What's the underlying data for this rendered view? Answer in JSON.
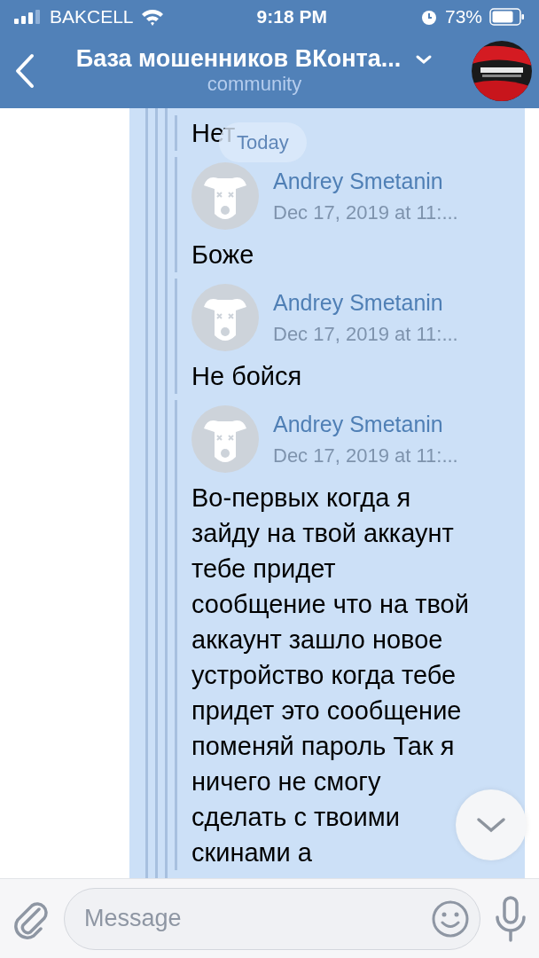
{
  "status_bar": {
    "carrier": "BAKCELL",
    "time": "9:18 PM",
    "battery": "73%"
  },
  "header": {
    "title": "База мошенников ВКонта...",
    "subtitle": "community"
  },
  "date_pill": "Today",
  "messages": [
    {
      "text": "Нет"
    },
    {
      "author": "Andrey Smetanin",
      "date": "Dec 17, 2019 at 11:...",
      "text": "Боже"
    },
    {
      "author": "Andrey Smetanin",
      "date": "Dec 17, 2019 at 11:...",
      "text": "Не бойся"
    },
    {
      "author": "Andrey Smetanin",
      "date": "Dec 17, 2019 at 11:...",
      "text": "Во-первых когда я зайду на твой аккаунт тебе придет сообщение что на твой аккаунт зашло новое устройство когда тебе придет это сообщение поменяй пароль Так я ничего не смогу сделать с твоими скинами а"
    }
  ],
  "composer": {
    "placeholder": "Message"
  }
}
